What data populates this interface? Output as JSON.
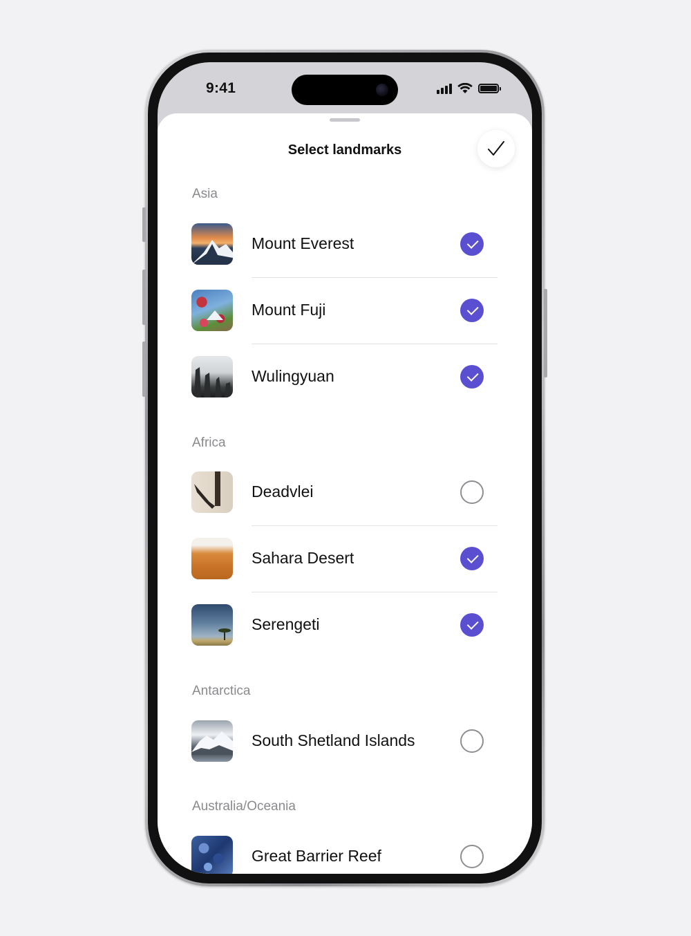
{
  "status_bar": {
    "time": "9:41"
  },
  "sheet": {
    "title": "Select landmarks",
    "done_icon": "checkmark-icon"
  },
  "sections": [
    {
      "header": "Asia",
      "items": [
        {
          "label": "Mount Everest",
          "selected": true
        },
        {
          "label": "Mount Fuji",
          "selected": true
        },
        {
          "label": "Wulingyuan",
          "selected": true
        }
      ]
    },
    {
      "header": "Africa",
      "items": [
        {
          "label": "Deadvlei",
          "selected": false
        },
        {
          "label": "Sahara Desert",
          "selected": true
        },
        {
          "label": "Serengeti",
          "selected": true
        }
      ]
    },
    {
      "header": "Antarctica",
      "items": [
        {
          "label": "South Shetland Islands",
          "selected": false
        }
      ]
    },
    {
      "header": "Australia/Oceania",
      "items": [
        {
          "label": "Great Barrier Reef",
          "selected": false
        }
      ]
    }
  ],
  "colors": {
    "accent": "#5b4fd1",
    "section_header": "#8a8a8e"
  }
}
